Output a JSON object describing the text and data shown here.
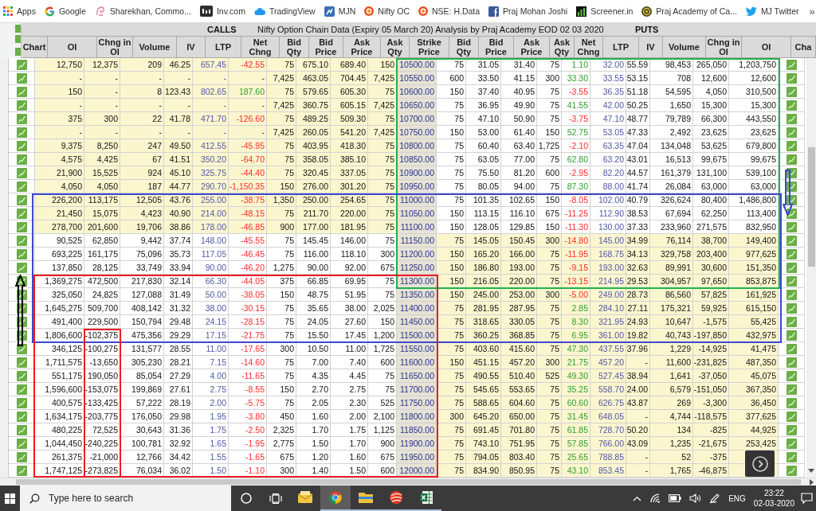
{
  "bookmarks_bar": {
    "items": [
      "Apps",
      "Google",
      "Sharekhan, Commo...",
      "Inv.com",
      "TradingView",
      "MJN",
      "Nifty OC",
      "NSE: H.Data",
      "Praj Mohan Joshi",
      "Screener.in",
      "Praj Academy of Ca...",
      "MJ Twitter"
    ],
    "overflow": "»"
  },
  "sheet": {
    "calls_label": "CALLS",
    "title": "Nifty Option Chain Data (Expiry 05 March 20) Analysis by Praj Academy EOD 02 03 2020",
    "puts_label": "PUTS",
    "columns": [
      "Chart",
      "OI",
      "Chng in OI",
      "Volume",
      "IV",
      "LTP",
      "Net Chng",
      "Bid Qty",
      "Bid Price",
      "Ask Price",
      "Ask Qty",
      "Strike Price",
      "Bid Qty",
      "Bid Price",
      "Ask Price",
      "Ask Qty",
      "Net Chng",
      "LTP",
      "IV",
      "Volume",
      "Chng in OI",
      "OI",
      "Cha"
    ],
    "rows": [
      {
        "strike": "10500.00",
        "calls": [
          "12,750",
          "12,375",
          "209",
          "46.25",
          "657.45",
          "75",
          "675.10",
          "689.40",
          "150"
        ],
        "calls_change": {
          "text": "-42.55",
          "rising": false
        },
        "calls_shaded": true,
        "puts": [
          "75",
          "31.05",
          "31.40",
          "75",
          "32.00",
          "55.59",
          "98,453",
          "265,050",
          "1,203,750"
        ],
        "puts_change": {
          "text": "1.10",
          "rising": true
        },
        "puts_shaded": false
      },
      {
        "strike": "10550.00",
        "calls": [
          "-",
          "-",
          "-",
          "-",
          "-",
          "7,425",
          "463.05",
          "704.45",
          "7,425"
        ],
        "calls_change": {
          "text": "-"
        },
        "calls_shaded": true,
        "puts": [
          "600",
          "33.50",
          "41.15",
          "300",
          "33.55",
          "53.15",
          "708",
          "12,600",
          "12,600"
        ],
        "puts_change": {
          "text": "33.30",
          "rising": true
        },
        "puts_shaded": false
      },
      {
        "strike": "10600.00",
        "calls": [
          "150",
          "-",
          "8",
          "123.43",
          "802.65",
          "75",
          "579.65",
          "605.30",
          "75"
        ],
        "calls_change": {
          "text": "187.60",
          "rising": true
        },
        "calls_shaded": true,
        "puts": [
          "150",
          "37.40",
          "40.95",
          "75",
          "36.35",
          "51.18",
          "54,595",
          "4,050",
          "310,500"
        ],
        "puts_change": {
          "text": "-3.55",
          "rising": false
        },
        "puts_shaded": false
      },
      {
        "strike": "10650.00",
        "calls": [
          "-",
          "-",
          "-",
          "-",
          "-",
          "7,425",
          "360.75",
          "605.15",
          "7,425"
        ],
        "calls_change": {
          "text": "-"
        },
        "calls_shaded": true,
        "puts": [
          "75",
          "36.95",
          "49.90",
          "75",
          "42.00",
          "50.25",
          "1,650",
          "15,300",
          "15,300"
        ],
        "puts_change": {
          "text": "41.55",
          "rising": true
        },
        "puts_shaded": false
      },
      {
        "strike": "10700.00",
        "calls": [
          "375",
          "300",
          "22",
          "41.78",
          "471.70",
          "75",
          "489.25",
          "509.30",
          "75"
        ],
        "calls_change": {
          "text": "-126.60",
          "rising": false
        },
        "calls_shaded": true,
        "puts": [
          "75",
          "47.10",
          "50.90",
          "75",
          "47.10",
          "48.77",
          "79,789",
          "66,300",
          "443,550"
        ],
        "puts_change": {
          "text": "-3.75",
          "rising": false
        },
        "puts_shaded": false
      },
      {
        "strike": "10750.00",
        "calls": [
          "-",
          "-",
          "-",
          "-",
          "-",
          "7,425",
          "260.05",
          "541.20",
          "7,425"
        ],
        "calls_change": {
          "text": "-"
        },
        "calls_shaded": true,
        "puts": [
          "150",
          "53.00",
          "61.40",
          "150",
          "53.05",
          "47.33",
          "2,492",
          "23,625",
          "23,625"
        ],
        "puts_change": {
          "text": "52.75",
          "rising": true
        },
        "puts_shaded": false
      },
      {
        "strike": "10800.00",
        "calls": [
          "9,375",
          "8,250",
          "247",
          "49.50",
          "412.55",
          "75",
          "403.95",
          "418.30",
          "75"
        ],
        "calls_change": {
          "text": "-45.95",
          "rising": false
        },
        "calls_shaded": true,
        "puts": [
          "75",
          "60.40",
          "63.40",
          "1,725",
          "63.35",
          "47.04",
          "134,048",
          "53,625",
          "679,800"
        ],
        "puts_change": {
          "text": "-2.10",
          "rising": false
        },
        "puts_shaded": false
      },
      {
        "strike": "10850.00",
        "calls": [
          "4,575",
          "4,425",
          "67",
          "41.51",
          "350.20",
          "75",
          "358.05",
          "385.10",
          "75"
        ],
        "calls_change": {
          "text": "-64.70",
          "rising": false
        },
        "calls_shaded": true,
        "puts": [
          "75",
          "63.05",
          "77.00",
          "75",
          "63.20",
          "43.01",
          "16,513",
          "99,675",
          "99,675"
        ],
        "puts_change": {
          "text": "62.80",
          "rising": true
        },
        "puts_shaded": false
      },
      {
        "strike": "10900.00",
        "calls": [
          "21,900",
          "15,525",
          "924",
          "45.10",
          "325.75",
          "75",
          "320.45",
          "337.05",
          "75"
        ],
        "calls_change": {
          "text": "-44.40",
          "rising": false
        },
        "calls_shaded": true,
        "puts": [
          "75",
          "75.50",
          "81.20",
          "600",
          "82.20",
          "44.57",
          "161,379",
          "131,100",
          "539,100"
        ],
        "puts_change": {
          "text": "-2.95",
          "rising": false
        },
        "puts_shaded": false
      },
      {
        "strike": "10950.00",
        "calls": [
          "4,050",
          "4,050",
          "187",
          "44.77",
          "290.70",
          "150",
          "276.00",
          "301.20",
          "75"
        ],
        "calls_change": {
          "text": "-1,150.35",
          "rising": false
        },
        "calls_shaded": true,
        "puts": [
          "75",
          "80.05",
          "94.00",
          "75",
          "88.00",
          "41.74",
          "26,084",
          "63,000",
          "63,000"
        ],
        "puts_change": {
          "text": "87.30",
          "rising": true
        },
        "puts_shaded": false
      },
      {
        "strike": "11000.00",
        "calls": [
          "226,200",
          "113,175",
          "12,505",
          "43.76",
          "255.00",
          "1,350",
          "250.00",
          "254.65",
          "75"
        ],
        "calls_change": {
          "text": "-38.75",
          "rising": false
        },
        "calls_shaded": true,
        "puts": [
          "75",
          "101.35",
          "102.65",
          "150",
          "102.00",
          "40.79",
          "326,624",
          "80,400",
          "1,486,800"
        ],
        "puts_change": {
          "text": "-8.05",
          "rising": false
        },
        "puts_shaded": false
      },
      {
        "strike": "11050.00",
        "calls": [
          "21,450",
          "15,075",
          "4,423",
          "40.90",
          "214.00",
          "75",
          "211.70",
          "220.00",
          "75"
        ],
        "calls_change": {
          "text": "-48.15",
          "rising": false
        },
        "calls_shaded": true,
        "puts": [
          "150",
          "113.15",
          "116.10",
          "675",
          "112.90",
          "38.53",
          "67,694",
          "62,250",
          "113,400"
        ],
        "puts_change": {
          "text": "-11.25",
          "rising": false
        },
        "puts_shaded": false
      },
      {
        "strike": "11100.00",
        "calls": [
          "278,700",
          "201,600",
          "19,706",
          "38.86",
          "178.00",
          "900",
          "177.00",
          "181.95",
          "75"
        ],
        "calls_change": {
          "text": "-46.85",
          "rising": false
        },
        "calls_shaded": true,
        "puts": [
          "150",
          "128.05",
          "129.85",
          "150",
          "130.00",
          "37.33",
          "233,960",
          "271,575",
          "832,950"
        ],
        "puts_change": {
          "text": "-11.30",
          "rising": false
        },
        "puts_shaded": false
      },
      {
        "strike": "11150.00",
        "calls": [
          "90,525",
          "62,850",
          "9,442",
          "37.74",
          "148.00",
          "75",
          "145.45",
          "146.00",
          "75"
        ],
        "calls_change": {
          "text": "-45.55",
          "rising": false
        },
        "calls_shaded": false,
        "puts": [
          "75",
          "145.05",
          "150.45",
          "300",
          "145.00",
          "34.99",
          "76,114",
          "38,700",
          "149,400"
        ],
        "puts_change": {
          "text": "-14.80",
          "rising": false
        },
        "puts_shaded": true
      },
      {
        "strike": "11200.00",
        "calls": [
          "693,225",
          "161,175",
          "75,096",
          "35.73",
          "117.05",
          "75",
          "116.00",
          "118.10",
          "300"
        ],
        "calls_change": {
          "text": "-46.45",
          "rising": false
        },
        "calls_shaded": false,
        "puts": [
          "150",
          "165.20",
          "166.00",
          "75",
          "168.75",
          "34.13",
          "329,758",
          "203,400",
          "977,625"
        ],
        "puts_change": {
          "text": "-11.95",
          "rising": false
        },
        "puts_shaded": true
      },
      {
        "strike": "11250.00",
        "calls": [
          "137,850",
          "28,125",
          "33,749",
          "33.94",
          "90.00",
          "1,275",
          "90.00",
          "92.00",
          "675"
        ],
        "calls_change": {
          "text": "-46.20",
          "rising": false
        },
        "calls_shaded": false,
        "puts": [
          "150",
          "186.80",
          "193.00",
          "75",
          "193.00",
          "32.63",
          "89,991",
          "30,600",
          "151,350"
        ],
        "puts_change": {
          "text": "-9.15",
          "rising": false
        },
        "puts_shaded": true
      },
      {
        "strike": "11300.00",
        "calls": [
          "1,369,275",
          "472,500",
          "217,830",
          "32.14",
          "66.30",
          "375",
          "66.85",
          "69.95",
          "75"
        ],
        "calls_change": {
          "text": "-44.05",
          "rising": false
        },
        "calls_shaded": false,
        "puts": [
          "150",
          "216.05",
          "220.00",
          "75",
          "214.95",
          "29.53",
          "304,957",
          "97,650",
          "853,875"
        ],
        "puts_change": {
          "text": "-13.15",
          "rising": false
        },
        "puts_shaded": true
      },
      {
        "strike": "11350.00",
        "calls": [
          "325,050",
          "24,825",
          "127,088",
          "31.49",
          "50.00",
          "150",
          "48.75",
          "51.95",
          "75"
        ],
        "calls_change": {
          "text": "-38.05",
          "rising": false
        },
        "calls_shaded": false,
        "puts": [
          "150",
          "245.00",
          "253.00",
          "300",
          "249.00",
          "28.73",
          "86,560",
          "57,825",
          "161,925"
        ],
        "puts_change": {
          "text": "-5.00",
          "rising": false
        },
        "puts_shaded": true
      },
      {
        "strike": "11400.00",
        "calls": [
          "1,645,275",
          "509,700",
          "408,142",
          "31.32",
          "38.00",
          "75",
          "35.65",
          "38.00",
          "2,025"
        ],
        "calls_change": {
          "text": "-30.15",
          "rising": false
        },
        "calls_shaded": false,
        "puts": [
          "75",
          "281.95",
          "287.95",
          "75",
          "284.10",
          "27.11",
          "175,321",
          "59,925",
          "615,150"
        ],
        "puts_change": {
          "text": "2.85",
          "rising": true
        },
        "puts_shaded": true
      },
      {
        "strike": "11450.00",
        "calls": [
          "491,400",
          "229,500",
          "150,794",
          "29.48",
          "24.15",
          "75",
          "24.05",
          "27.60",
          "150"
        ],
        "calls_change": {
          "text": "-28.15",
          "rising": false
        },
        "calls_shaded": false,
        "puts": [
          "75",
          "318.65",
          "330.05",
          "75",
          "321.95",
          "24.93",
          "10,647",
          "-1,575",
          "55,425"
        ],
        "puts_change": {
          "text": "8.30",
          "rising": true
        },
        "puts_shaded": true
      },
      {
        "strike": "11500.00",
        "calls": [
          "1,806,600",
          "-102,375",
          "475,356",
          "29.29",
          "17.15",
          "75",
          "15.50",
          "17.45",
          "1,200"
        ],
        "calls_change": {
          "text": "-21.75",
          "rising": false
        },
        "calls_shaded": false,
        "puts": [
          "75",
          "360.25",
          "368.85",
          "75",
          "361.00",
          "19.82",
          "40,743",
          "-197,850",
          "432,975"
        ],
        "puts_change": {
          "text": "6.95",
          "rising": true
        },
        "puts_shaded": true
      },
      {
        "strike": "11550.00",
        "calls": [
          "346,125",
          "-100,275",
          "131,577",
          "28.55",
          "11.00",
          "300",
          "10.50",
          "11.00",
          "1,725"
        ],
        "calls_change": {
          "text": "-17.65",
          "rising": false
        },
        "calls_shaded": false,
        "puts": [
          "75",
          "403.60",
          "415.60",
          "75",
          "437.55",
          "37.96",
          "1,229",
          "-14,925",
          "41,475"
        ],
        "puts_change": {
          "text": "47.30",
          "rising": true
        },
        "puts_shaded": true
      },
      {
        "strike": "11600.00",
        "calls": [
          "1,711,575",
          "-13,650",
          "305,230",
          "28.21",
          "7.15",
          "75",
          "7.00",
          "7.40",
          "600"
        ],
        "calls_change": {
          "text": "-14.60",
          "rising": false
        },
        "calls_shaded": false,
        "puts": [
          "150",
          "451.15",
          "457.20",
          "300",
          "457.20",
          "-",
          "11,600",
          "-231,825",
          "487,350"
        ],
        "puts_change": {
          "text": "21.75",
          "rising": true
        },
        "puts_shaded": true
      },
      {
        "strike": "11650.00",
        "calls": [
          "551,175",
          "190,050",
          "85,054",
          "27.29",
          "4.00",
          "75",
          "4.35",
          "4.45",
          "75"
        ],
        "calls_change": {
          "text": "-11.65",
          "rising": false
        },
        "calls_shaded": false,
        "puts": [
          "75",
          "490.55",
          "510.40",
          "525",
          "527.45",
          "38.94",
          "1,641",
          "-37,050",
          "45,075"
        ],
        "puts_change": {
          "text": "49.30",
          "rising": true
        },
        "puts_shaded": true
      },
      {
        "strike": "11700.00",
        "calls": [
          "1,596,600",
          "-153,075",
          "199,869",
          "27.61",
          "2.75",
          "150",
          "2.70",
          "2.75",
          "75"
        ],
        "calls_change": {
          "text": "-8.55",
          "rising": false
        },
        "calls_shaded": false,
        "puts": [
          "75",
          "545.65",
          "553.65",
          "75",
          "558.70",
          "24.00",
          "6,579",
          "-151,050",
          "367,350"
        ],
        "puts_change": {
          "text": "35.25",
          "rising": true
        },
        "puts_shaded": true
      },
      {
        "strike": "11750.00",
        "calls": [
          "400,575",
          "-133,425",
          "57,222",
          "28.19",
          "2.00",
          "75",
          "2.05",
          "2.30",
          "525"
        ],
        "calls_change": {
          "text": "-5.75",
          "rising": false
        },
        "calls_shaded": false,
        "puts": [
          "75",
          "588.65",
          "604.60",
          "75",
          "626.75",
          "43.87",
          "269",
          "-3,300",
          "36,450"
        ],
        "puts_change": {
          "text": "60.60",
          "rising": true
        },
        "puts_shaded": true
      },
      {
        "strike": "11800.00",
        "calls": [
          "1,634,175",
          "-203,775",
          "176,050",
          "29.98",
          "1.95",
          "450",
          "1.60",
          "2.00",
          "2,100"
        ],
        "calls_change": {
          "text": "-3.80",
          "rising": false
        },
        "calls_shaded": false,
        "puts": [
          "300",
          "645.20",
          "650.00",
          "75",
          "648.05",
          "-",
          "4,744",
          "-118,575",
          "377,625"
        ],
        "puts_change": {
          "text": "31.45",
          "rising": true
        },
        "puts_shaded": true
      },
      {
        "strike": "11850.00",
        "calls": [
          "480,225",
          "72,525",
          "30,643",
          "31.36",
          "1.75",
          "2,325",
          "1.70",
          "1.75",
          "1,125"
        ],
        "calls_change": {
          "text": "-2.50",
          "rising": false
        },
        "calls_shaded": false,
        "puts": [
          "75",
          "691.45",
          "701.80",
          "75",
          "728.70",
          "50.20",
          "134",
          "-825",
          "44,925"
        ],
        "puts_change": {
          "text": "61.85",
          "rising": true
        },
        "puts_shaded": true
      },
      {
        "strike": "11900.00",
        "calls": [
          "1,044,450",
          "-240,225",
          "100,781",
          "32.92",
          "1.65",
          "2,775",
          "1.50",
          "1.70",
          "900"
        ],
        "calls_change": {
          "text": "-1.95",
          "rising": false
        },
        "calls_shaded": false,
        "puts": [
          "75",
          "743.10",
          "751.95",
          "75",
          "766.00",
          "43.09",
          "1,235",
          "-21,675",
          "253,425"
        ],
        "puts_change": {
          "text": "57.85",
          "rising": true
        },
        "puts_shaded": true
      },
      {
        "strike": "11950.00",
        "calls": [
          "261,375",
          "-21,000",
          "12,766",
          "34.42",
          "1.55",
          "675",
          "1.20",
          "1.60",
          "675"
        ],
        "calls_change": {
          "text": "-1.65",
          "rising": false
        },
        "calls_shaded": false,
        "puts": [
          "75",
          "794.05",
          "803.40",
          "75",
          "788.85",
          "-",
          "52",
          "-375"
        ],
        "puts_change": {
          "text": "25.65",
          "rising": true
        },
        "puts_shaded": true
      },
      {
        "strike": "12000.00",
        "calls": [
          "1,747,125",
          "-273,825",
          "76,034",
          "36.02",
          "1.50",
          "300",
          "1.40",
          "1.50",
          "600"
        ],
        "calls_change": {
          "text": "-1.10",
          "rising": false
        },
        "calls_shaded": false,
        "puts": [
          "75",
          "834.90",
          "850.95",
          "75",
          "853.45",
          "-",
          "1,765",
          "-46,875"
        ],
        "puts_change": {
          "text": "43.10",
          "rising": true
        },
        "puts_shaded": true
      }
    ]
  },
  "annotations": [
    {
      "kind": "frame",
      "color": "#22b14c"
    },
    {
      "kind": "frame",
      "color": "#3f48cc"
    },
    {
      "kind": "frame",
      "color": "#ed1c24"
    },
    {
      "kind": "frame",
      "color": "#ed1c24"
    },
    {
      "kind": "arrow",
      "points_up": true,
      "color": "#000000"
    },
    {
      "kind": "arrow",
      "points_up": false,
      "color": "#3f48cc"
    }
  ],
  "taskbar": {
    "search": {
      "placeholder": "Type here to search"
    },
    "apps": [
      {
        "selected": false,
        "running": false
      },
      {
        "selected": true,
        "running": true
      },
      {
        "selected": false,
        "running": true
      },
      {
        "selected": false,
        "running": true
      },
      {
        "selected": false,
        "running": true
      }
    ],
    "language": "ENG",
    "time": "23:22",
    "date": "02-03-2020"
  }
}
